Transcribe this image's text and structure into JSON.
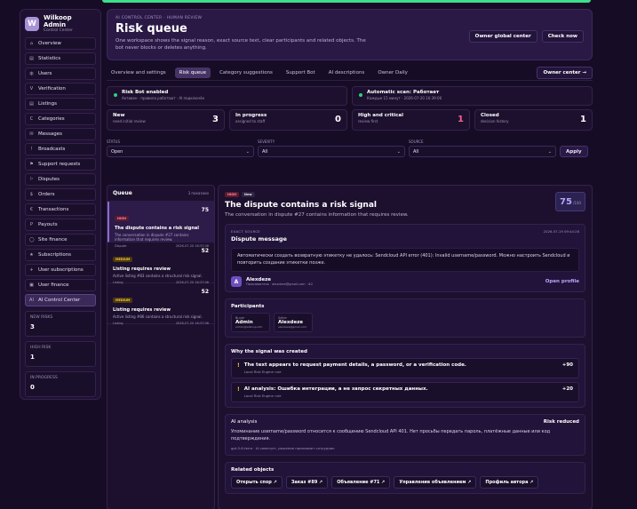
{
  "brand": {
    "name": "Wilkoop Admin",
    "subtitle": "Control Center",
    "logo_letter": "W"
  },
  "sidebar": {
    "items": [
      {
        "label": "Overview",
        "icon": "⌂"
      },
      {
        "label": "Statistics",
        "icon": "▤"
      },
      {
        "label": "Users",
        "icon": "◍"
      },
      {
        "label": "Verification",
        "icon": "V"
      },
      {
        "label": "Listings",
        "icon": "▤"
      },
      {
        "label": "Categories",
        "icon": "C"
      },
      {
        "label": "Messages",
        "icon": "✉"
      },
      {
        "label": "Broadcasts",
        "icon": "!"
      },
      {
        "label": "Support requests",
        "icon": "⚑"
      },
      {
        "label": "Disputes",
        "icon": "⚐"
      },
      {
        "label": "Orders",
        "icon": "$"
      },
      {
        "label": "Transactions",
        "icon": "€"
      },
      {
        "label": "Payouts",
        "icon": "P"
      },
      {
        "label": "Site finance",
        "icon": "◯"
      },
      {
        "label": "Subscriptions",
        "icon": "★"
      },
      {
        "label": "User subscriptions",
        "icon": "+"
      },
      {
        "label": "User finance",
        "icon": "▣"
      },
      {
        "label": "AI Control Center",
        "icon": "AI"
      }
    ],
    "stats": [
      {
        "label": "New risks",
        "value": "3"
      },
      {
        "label": "High risk",
        "value": "1"
      },
      {
        "label": "In progress",
        "value": "0"
      }
    ]
  },
  "header": {
    "eyebrow": "AI control center · human review",
    "title": "Risk queue",
    "description": "One workspace shows the signal reason, exact source text, clear participants and related objects. The bot never blocks or deletes anything.",
    "btn_global": "Owner global center",
    "btn_now": "Check now"
  },
  "tabs": {
    "items": [
      "Overview and settings",
      "Risk queue",
      "Category suggestions",
      "Support Bot",
      "AI descriptions",
      "Owner Daily"
    ],
    "right": "Owner center →"
  },
  "status": {
    "bot_title": "Risk Bot enabled",
    "bot_sub": "Активен · правила работают · AI подключён",
    "scan_title": "Automatic scan: Работает",
    "scan_sub": "Каждые 15 минут · 2026-07-20 16:39:06"
  },
  "counts": [
    {
      "title": "New",
      "sub": "need initial review",
      "value": "3"
    },
    {
      "title": "In progress",
      "sub": "assigned to staff",
      "value": "0"
    },
    {
      "title": "High and critical",
      "sub": "review first",
      "value": "1"
    },
    {
      "title": "Closed",
      "sub": "decision history",
      "value": "1"
    }
  ],
  "filters": {
    "status_label": "Status",
    "status_value": "Open",
    "severity_label": "Severity",
    "severity_value": "All",
    "source_label": "Source",
    "source_value": "All",
    "apply": "Apply"
  },
  "queue": {
    "title": "Queue",
    "count": "3 показано",
    "items": [
      {
        "badge": "HIGH",
        "score": "75",
        "title": "The dispute contains a risk signal",
        "desc": "The conversation in dispute #27 contains information that requires review.",
        "type": "Dispute",
        "time": "2026-07-20 16:37:06"
      },
      {
        "badge": "MEDIUM",
        "score": "52",
        "title": "Listing requires review",
        "desc": "Active listing #83 contains a structural risk signal.",
        "type": "Listing",
        "time": "2026-07-20 16:37:06"
      },
      {
        "badge": "MEDIUM",
        "score": "52",
        "title": "Listing requires review",
        "desc": "Active listing #86 contains a structural risk signal.",
        "type": "Listing",
        "time": "2026-07-20 16:37:06"
      }
    ]
  },
  "detail": {
    "badge_high": "HIGH",
    "badge_new": "New",
    "title": "The dispute contains a risk signal",
    "subtitle": "The conversation in dispute #27 contains information that requires review.",
    "score": "75",
    "score_of": "/100",
    "source": {
      "eyebrow": "Exact source",
      "time": "2026-07-19 09:44:26",
      "title": "Dispute message",
      "text": "Автоматически создать возвратную этикетку не удалось: Sendcloud API error (401): Invalid username/password. Можно настроить Sendcloud и повторить создание этикетки позже.",
      "author_initial": "A",
      "author_name": "Alexdeze",
      "author_sub": "Пользователь · alexdeze@gmail.com · #2",
      "open_profile": "Open profile"
    },
    "participants": {
      "title": "Participants",
      "items": [
        {
          "role": "Buyer",
          "name": "Admin",
          "mail": "admin@wilkoop.info"
        },
        {
          "role": "Seller",
          "name": "Alexdeze",
          "mail": "alexdeze@gmail.com"
        }
      ]
    },
    "why": {
      "title": "Why the signal was created",
      "items": [
        {
          "title": "The text appears to request payment details, a password, or a verification code.",
          "src": "Local Risk Engine rule",
          "pts": "+90"
        },
        {
          "title": "AI analysis: Ошибка интеграции, а не запрос секретных данных.",
          "src": "Local Risk Engine rule",
          "pts": "+20"
        }
      ]
    },
    "ai": {
      "title": "AI analysis",
      "verdict": "Risk reduced",
      "text": "Упоминание username/password относится к сообщению Sendcloud API 401. Нет просьбы передать пароль, платёжные данные или код подтверждения.",
      "foot": "gpt-5.6-terra · AI советует, решение принимает сотрудник"
    },
    "related": {
      "title": "Related objects",
      "items": [
        "Открыть спор ↗",
        "Заказ #89 ↗",
        "Объявление #71 ↗",
        "Управление объявлением ↗",
        "Профиль автора ↗"
      ]
    }
  }
}
